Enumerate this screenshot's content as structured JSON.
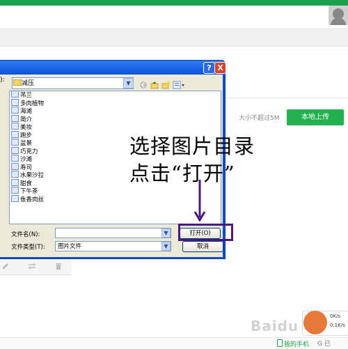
{
  "page": {
    "size_limit": "大小不超过5M",
    "upload_button": "本地上传",
    "footer_phone": "我的手机",
    "footer_extra": "G 已",
    "speed_up": "0K/s",
    "speed_down": "0.1K/s",
    "watermark": "Baidu 经验"
  },
  "dialog": {
    "help_label": "?",
    "close_label": "X",
    "lookin_label": "):",
    "lookin_value": "减压",
    "files": [
      "吊兰",
      "多肉植物",
      "海滩",
      "简介",
      "美妆",
      "跑步",
      "盆景",
      "巧克力",
      "沙滩",
      "寿司",
      "水果沙拉",
      "甜食",
      "下午茶",
      "鱼香肉丝"
    ],
    "filename_label": "文件名(N):",
    "filename_value": "",
    "filetype_label": "文件类型(T):",
    "filetype_value": "图片文件",
    "open_button": "打开(O)",
    "cancel_button": "取消"
  },
  "annotation": {
    "line1": "选择图片目录",
    "line2": "点击“打开”"
  },
  "colors": {
    "accent_green": "#22b14c",
    "highlight_purple": "#4b1880"
  }
}
